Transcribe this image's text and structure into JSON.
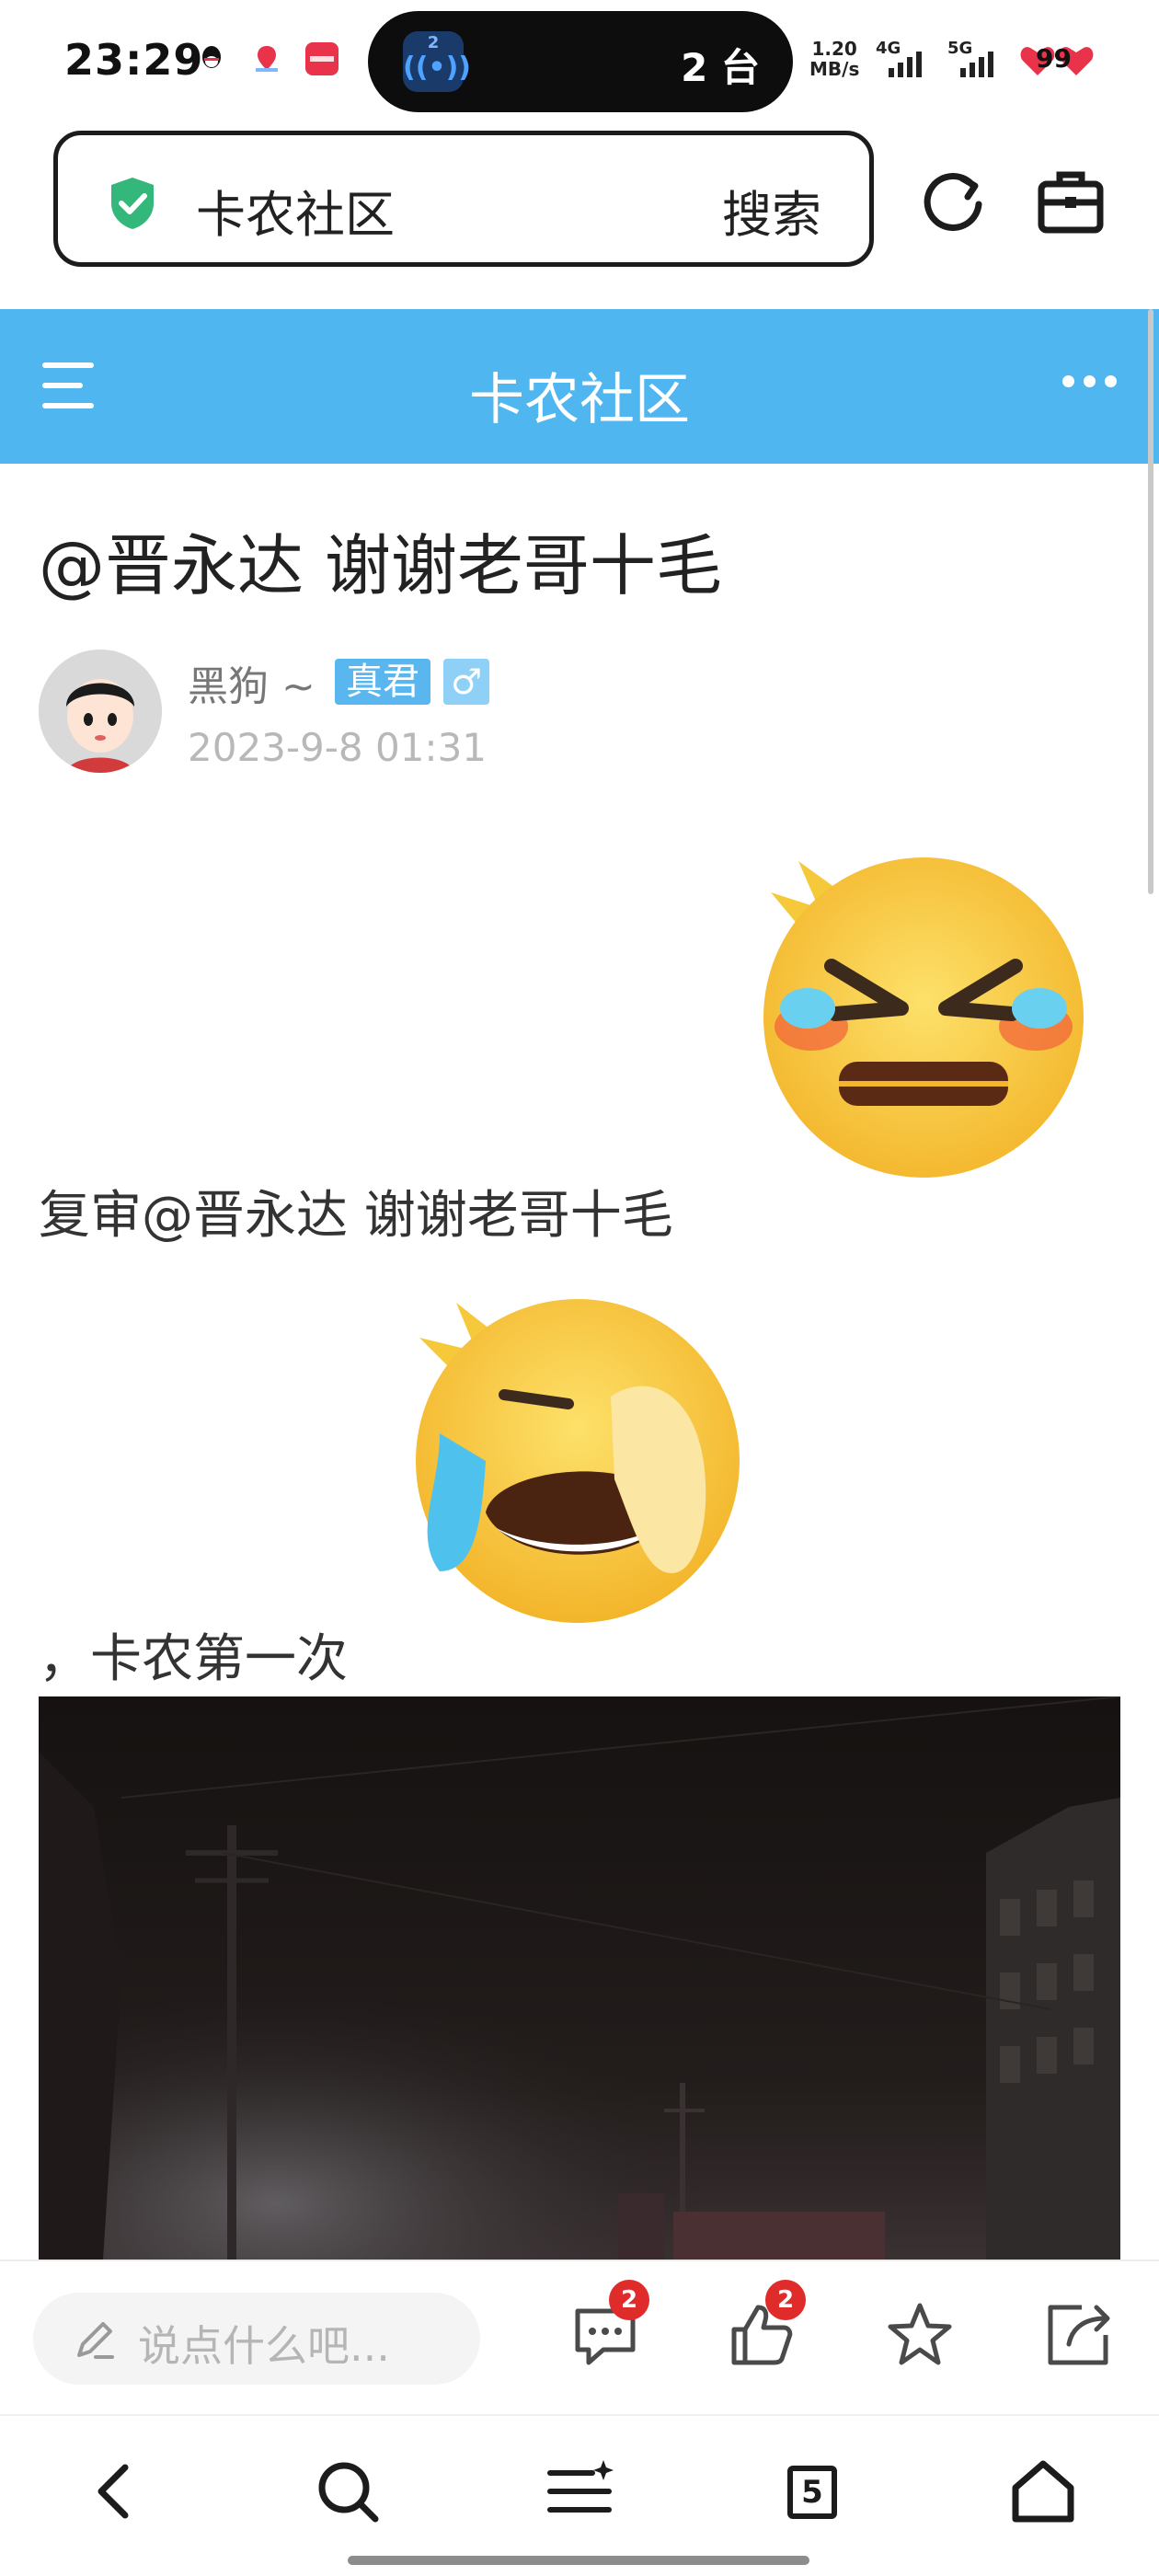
{
  "status_bar": {
    "time": "23:29",
    "island_badge": "2",
    "island_text": "2 台",
    "net_speed_value": "1.20",
    "net_speed_unit": "MB/s",
    "sim1": "4G",
    "sim2": "5G",
    "battery": "99"
  },
  "address_bar": {
    "title": "卡农社区",
    "search_label": "搜索"
  },
  "header": {
    "title": "卡农社区"
  },
  "post": {
    "title": "@晋永达 谢谢老哥十毛",
    "author": {
      "name": "黑狗 ~",
      "level_badge": "真君",
      "gender_badge": "♂"
    },
    "date": "2023-9-8 01:31",
    "content_line1": "复审@晋永达 谢谢老哥十毛",
    "content_line2": "，卡农第一次"
  },
  "action_bar": {
    "comment_placeholder": "说点什么吧...",
    "comment_count": "2",
    "like_count": "2"
  },
  "browser_nav": {
    "tab_count": "5"
  },
  "colors": {
    "header": "#50b6ef",
    "badge_red": "#e02b2b",
    "shield_green": "#34b77a"
  }
}
